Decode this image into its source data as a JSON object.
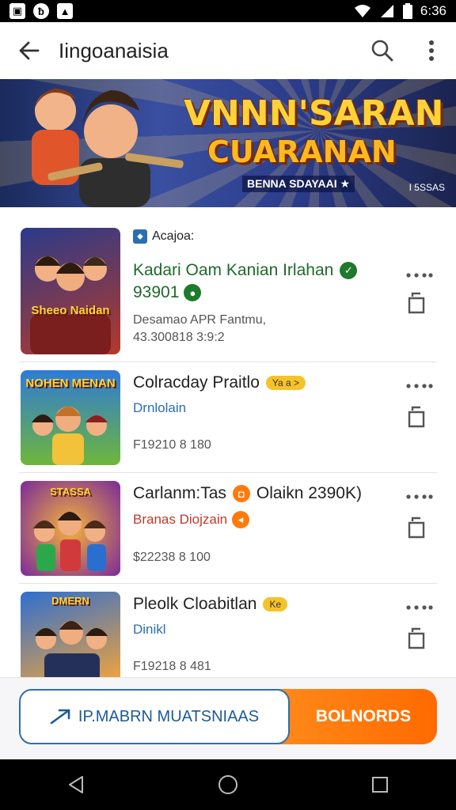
{
  "status_bar": {
    "time": "6:36",
    "left_icons": [
      "image-icon",
      "alpha-icon",
      "photo-icon"
    ],
    "right_icons": [
      "wifi-icon",
      "signal-icon",
      "battery-icon"
    ]
  },
  "app_bar": {
    "title": "Iingoanaisia",
    "back_icon": "arrow-left-icon",
    "search_icon": "search-icon",
    "menu_icon": "more-vertical-icon"
  },
  "banner": {
    "title_line1": "VNNN'SARAN",
    "title_line2": "CUARANAN",
    "subtitle": "BENNA SDAYAAI ★",
    "corner_text": "I 5SSAS"
  },
  "list": {
    "items": [
      {
        "thumb_label": "Sheeo Naidan",
        "pin_label": "Acajoa:",
        "title": "Kadari Oam Kanian Irlahan",
        "subtitle": "93901",
        "meta_line1": "Desamao APR Fantmu,",
        "meta_line2": "43.300818 3:9:2",
        "accent": "#1f7a2e"
      },
      {
        "thumb_label": "NOHEN MENAN",
        "title": "Colracday Praitlo",
        "badge": "Ya a >",
        "subtitle": "Drnlolain",
        "meta_line1": "F19210 8 180",
        "accent": "#2a6fb0"
      },
      {
        "thumb_label": "STASSA",
        "title": "Carlanm:Tas",
        "title_extra": "Olaikn 2390K)",
        "subtitle": "Branas Diojzain",
        "meta_line1": "$22238 8 100",
        "accent": "#c0392b"
      },
      {
        "thumb_label": "DMERN",
        "title": "Pleolk Cloabitlan",
        "badge": "Ke",
        "subtitle": "Dinikl",
        "meta_line1": "F19218 8 481",
        "accent": "#2a6fb0"
      }
    ]
  },
  "bottom": {
    "primary_label": "IP.MABRN MUATSNIAAS",
    "secondary_label": "BOLNORDS"
  },
  "nav": {
    "back": "nav-back-icon",
    "home": "nav-home-icon",
    "recents": "nav-recents-icon"
  },
  "colors": {
    "accent_blue": "#2c6fb0",
    "accent_orange": "#ff7a0a",
    "badge_yellow": "#f6c22a"
  }
}
